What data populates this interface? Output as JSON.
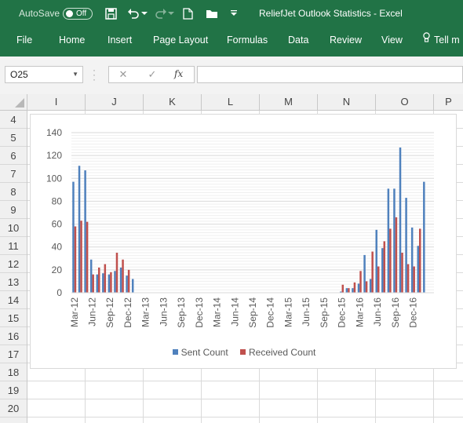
{
  "titlebar": {
    "autosave_label": "AutoSave",
    "autosave_state": "Off",
    "window_title": "ReliefJet Outlook Statistics  -  Excel",
    "icons": [
      "save-icon",
      "undo-icon",
      "redo-icon",
      "new-file-icon",
      "open-folder-icon",
      "customize-qat-icon"
    ]
  },
  "ribbon": {
    "tabs": [
      "File",
      "Home",
      "Insert",
      "Page Layout",
      "Formulas",
      "Data",
      "Review",
      "View"
    ],
    "tell_me": "Tell m"
  },
  "formula_bar": {
    "name_box": "O25",
    "fx_label": "fx",
    "formula": ""
  },
  "sheet": {
    "columns": [
      "I",
      "J",
      "K",
      "L",
      "M",
      "N",
      "O",
      "P"
    ],
    "rows": [
      "4",
      "5",
      "6",
      "7",
      "8",
      "9",
      "10",
      "11",
      "12",
      "13",
      "14",
      "15",
      "16",
      "17",
      "18",
      "19",
      "20"
    ]
  },
  "chart_data": {
    "type": "bar",
    "categories": [
      "Mar-12",
      "Apr-12",
      "May-12",
      "Jun-12",
      "Jul-12",
      "Aug-12",
      "Sep-12",
      "Oct-12",
      "Nov-12",
      "Dec-12",
      "Jan-13",
      "Feb-13",
      "Mar-13",
      "Apr-13",
      "May-13",
      "Jun-13",
      "Jul-13",
      "Aug-13",
      "Sep-13",
      "Oct-13",
      "Nov-13",
      "Dec-13",
      "Jan-14",
      "Feb-14",
      "Mar-14",
      "Apr-14",
      "May-14",
      "Jun-14",
      "Jul-14",
      "Aug-14",
      "Sep-14",
      "Oct-14",
      "Nov-14",
      "Dec-14",
      "Jan-15",
      "Feb-15",
      "Mar-15",
      "Apr-15",
      "May-15",
      "Jun-15",
      "Jul-15",
      "Aug-15",
      "Sep-15",
      "Oct-15",
      "Nov-15",
      "Dec-15",
      "Jan-16",
      "Feb-16",
      "Mar-16",
      "Apr-16",
      "May-16",
      "Jun-16",
      "Jul-16",
      "Aug-16",
      "Sep-16",
      "Oct-16",
      "Nov-16",
      "Dec-16",
      "Jan-17",
      "Feb-17",
      "Mar-17"
    ],
    "tick_labels": [
      "Mar-12",
      "Jun-12",
      "Sep-12",
      "Dec-12",
      "Mar-13",
      "Jun-13",
      "Sep-13",
      "Dec-13",
      "Mar-14",
      "Jun-14",
      "Sep-14",
      "Dec-14",
      "Mar-15",
      "Jun-15",
      "Sep-15",
      "Dec-15",
      "Mar-16",
      "Jun-16",
      "Sep-16",
      "Dec-16"
    ],
    "series": [
      {
        "name": "Sent Count",
        "color": "#4f81bd",
        "values": [
          97,
          111,
          107,
          29,
          16,
          17,
          16,
          19,
          22,
          15,
          12,
          0,
          0,
          0,
          0,
          0,
          0,
          0,
          0,
          0,
          0,
          0,
          0,
          0,
          0,
          0,
          0,
          0,
          0,
          0,
          0,
          0,
          0,
          0,
          0,
          0,
          0,
          0,
          0,
          0,
          0,
          0,
          0,
          0,
          0,
          1,
          4,
          4,
          8,
          33,
          12,
          55,
          39,
          91,
          91,
          127,
          83,
          57,
          41,
          97
        ]
      },
      {
        "name": "Received Count",
        "color": "#c0504d",
        "values": [
          58,
          63,
          62,
          16,
          22,
          25,
          18,
          35,
          29,
          20,
          0,
          0,
          0,
          0,
          0,
          0,
          0,
          0,
          0,
          0,
          0,
          0,
          0,
          0,
          0,
          0,
          0,
          0,
          0,
          0,
          0,
          0,
          0,
          0,
          0,
          0,
          0,
          0,
          0,
          0,
          0,
          0,
          0,
          0,
          0,
          7,
          4,
          9,
          19,
          10,
          36,
          23,
          45,
          56,
          66,
          35,
          25,
          23,
          56
        ]
      }
    ],
    "ylim": [
      0,
      140
    ],
    "yticks": [
      0,
      20,
      40,
      60,
      80,
      100,
      120,
      140
    ],
    "grid": true,
    "legend_position": "bottom"
  }
}
